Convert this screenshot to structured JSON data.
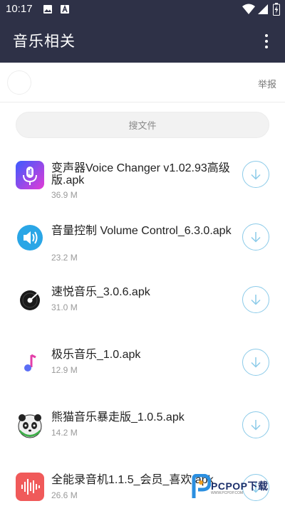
{
  "status_bar": {
    "time": "10:17",
    "left_icons": [
      "image-icon",
      "a-letter-icon"
    ],
    "right_icons": [
      "wifi-icon",
      "signal-icon",
      "battery-charging-icon"
    ]
  },
  "app_bar": {
    "title": "音乐相关",
    "menu_icon": "more-vert-icon",
    "background": "#2e3147"
  },
  "profile": {
    "report_label": "举报"
  },
  "search": {
    "label": "搜文件"
  },
  "files": [
    {
      "name": "变声器Voice Changer v1.02.93高级版.apk",
      "size": "36.9 M",
      "icon": "voice-changer-icon"
    },
    {
      "name": "音量控制 Volume Control_6.3.0.apk",
      "size": "23.2 M",
      "icon": "volume-control-icon"
    },
    {
      "name": "速悦音乐_3.0.6.apk",
      "size": "31.0 M",
      "icon": "suyue-music-icon"
    },
    {
      "name": "极乐音乐_1.0.apk",
      "size": "12.9 M",
      "icon": "jile-music-icon"
    },
    {
      "name": "熊猫音乐暴走版_1.0.5.apk",
      "size": "14.2 M",
      "icon": "panda-music-icon"
    },
    {
      "name": "全能录音机1.1.5_会员_喜欢.apk",
      "size": "26.6 M",
      "icon": "recorder-icon"
    }
  ],
  "download_icon": "download-arrow-icon",
  "colors": {
    "accent": "#8ccbe9",
    "header": "#2e3147"
  },
  "watermark": {
    "text": "PCPOP下载",
    "sub": "WWW.PCPOP.COM"
  }
}
